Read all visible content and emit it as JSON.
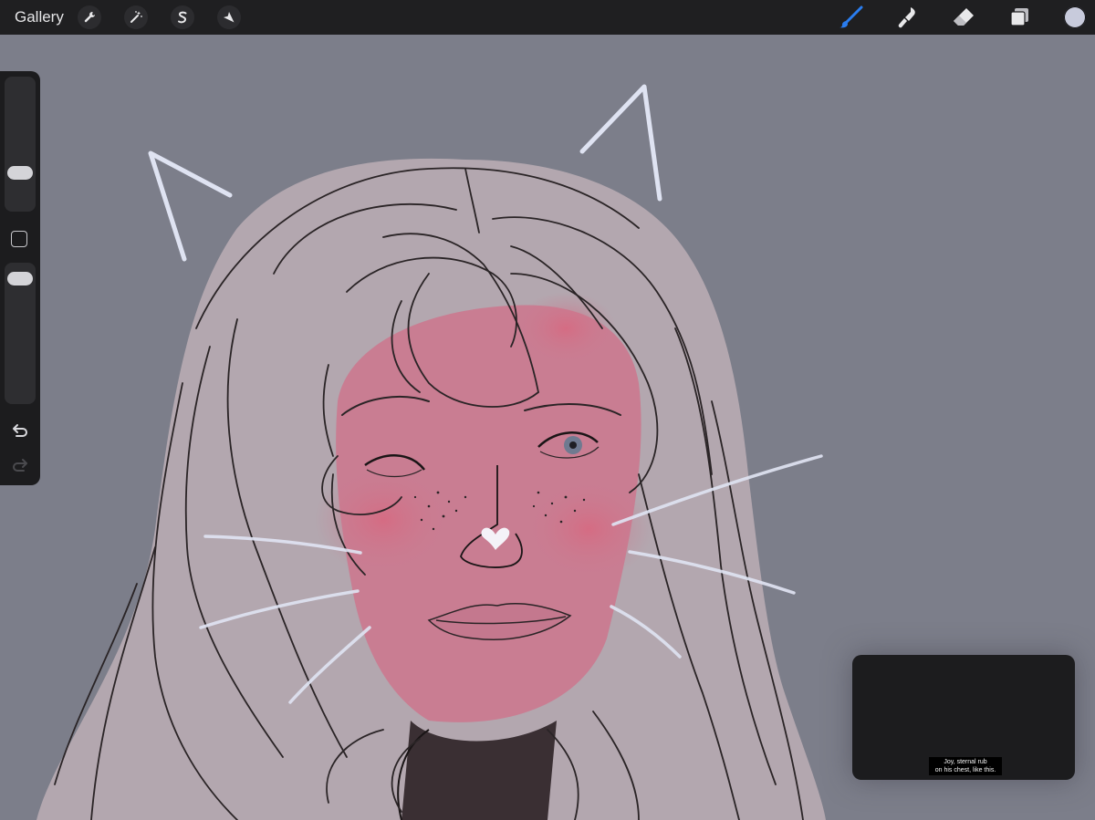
{
  "toolbar": {
    "gallery_label": "Gallery",
    "left_tools": [
      "wrench-icon",
      "magic-wand-icon",
      "selection-s-icon",
      "arrow-transform-icon"
    ],
    "right_tools": [
      "brush-icon",
      "smudge-icon",
      "eraser-icon",
      "layers-icon"
    ],
    "color_current": "#c8cbdc",
    "accent": "#2a7df0"
  },
  "sidebar": {
    "brush_size": 0.7,
    "opacity": 0.95,
    "undo_icon": "undo-icon",
    "redo_icon": "redo-icon"
  },
  "canvas": {
    "background": "#7c7e8a",
    "skin_tone": "#c97d92",
    "hair_tone": "#b3a7af",
    "whisker_color": "#dfe3f2"
  },
  "video_overlay": {
    "caption_line1": "Joy, sternal rub",
    "caption_line2": "on his chest, like this."
  }
}
